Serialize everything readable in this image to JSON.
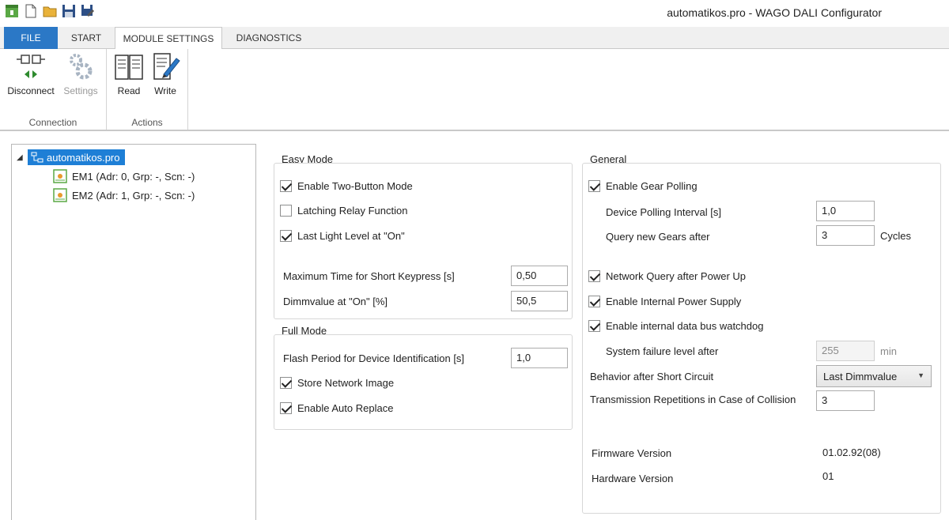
{
  "window": {
    "title": "automatikos.pro - WAGO DALI Configurator"
  },
  "quick_access": [
    "app-icon",
    "new-file-icon",
    "open-folder-icon",
    "save-icon",
    "save-as-icon"
  ],
  "tabs": {
    "file": "FILE",
    "start": "START",
    "module_settings": "MODULE SETTINGS",
    "diagnostics": "DIAGNOSTICS"
  },
  "ribbon": {
    "connection": {
      "label": "Connection",
      "disconnect": "Disconnect",
      "settings": "Settings"
    },
    "actions": {
      "label": "Actions",
      "read": "Read",
      "write": "Write"
    }
  },
  "tree": {
    "root": "automatikos.pro",
    "children": [
      "EM1 (Adr: 0, Grp: -, Scn: -)",
      "EM2 (Adr: 1, Grp: -, Scn: -)"
    ]
  },
  "easy_mode": {
    "title": "Easy Mode",
    "two_button": {
      "label": "Enable Two-Button Mode",
      "checked": true
    },
    "latching": {
      "label": "Latching Relay Function",
      "checked": false
    },
    "last_light": {
      "label": "Last Light Level at \"On\"",
      "checked": true
    },
    "short_keypress": {
      "label": "Maximum Time for Short Keypress [s]",
      "value": "0,50"
    },
    "dimmvalue": {
      "label": "Dimmvalue at \"On\" [%]",
      "value": "50,5"
    }
  },
  "full_mode": {
    "title": "Full Mode",
    "flash_period": {
      "label": "Flash Period for Device Identification [s]",
      "value": "1,0"
    },
    "store_image": {
      "label": "Store Network Image",
      "checked": true
    },
    "auto_replace": {
      "label": "Enable Auto Replace",
      "checked": true
    }
  },
  "general": {
    "title": "General",
    "gear_polling": {
      "label": "Enable Gear Polling",
      "checked": true
    },
    "polling_interval": {
      "label": "Device Polling Interval [s]",
      "value": "1,0"
    },
    "query_gears": {
      "label": "Query new Gears after",
      "value": "3",
      "unit": "Cycles"
    },
    "network_query": {
      "label": "Network Query after Power Up",
      "checked": true
    },
    "internal_power": {
      "label": "Enable Internal Power Supply",
      "checked": true
    },
    "watchdog": {
      "label": "Enable internal data bus watchdog",
      "checked": true
    },
    "failure_level": {
      "label": "System failure level after",
      "value": "255",
      "unit": "min"
    },
    "short_circuit": {
      "label": "Behavior after Short Circuit",
      "value": "Last Dimmvalue"
    },
    "repetitions": {
      "label": "Transmission Repetitions in Case of Collision",
      "value": "3"
    },
    "firmware": {
      "label": "Firmware Version",
      "value": "01.02.92(08)"
    },
    "hardware": {
      "label": "Hardware Version",
      "value": "01"
    }
  },
  "colors": {
    "accent": "#2b78c6",
    "selection": "#1e7fd6"
  }
}
